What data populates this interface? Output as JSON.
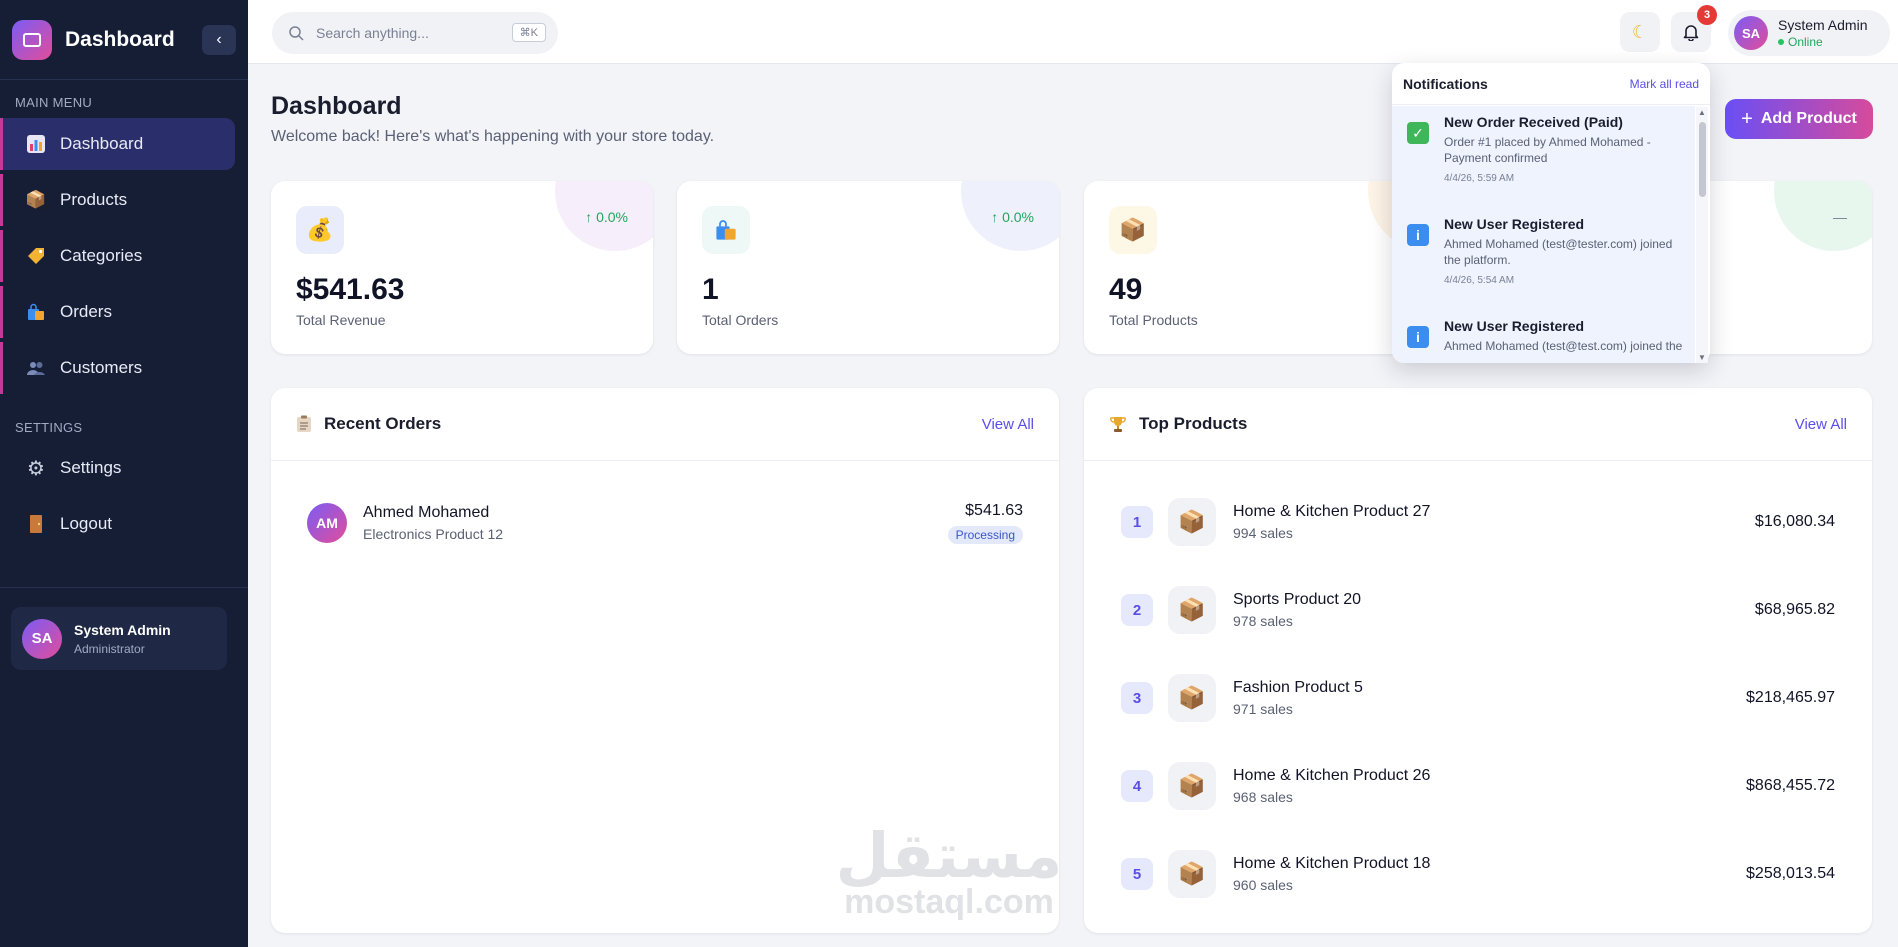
{
  "sidebar": {
    "title": "Dashboard",
    "collapse_icon": "chevron-left-icon",
    "main_menu_label": "MAIN MENU",
    "settings_label": "SETTINGS",
    "items": [
      {
        "label": "Dashboard",
        "icon": "chart-icon"
      },
      {
        "label": "Products",
        "icon": "package-icon"
      },
      {
        "label": "Categories",
        "icon": "tag-icon"
      },
      {
        "label": "Orders",
        "icon": "shopping-bag-icon"
      },
      {
        "label": "Customers",
        "icon": "users-icon"
      }
    ],
    "settings_items": [
      {
        "label": "Settings",
        "icon": "gear-icon"
      },
      {
        "label": "Logout",
        "icon": "door-icon"
      }
    ],
    "user": {
      "initials": "SA",
      "name": "System Admin",
      "role": "Administrator"
    }
  },
  "header": {
    "search_placeholder": "Search anything...",
    "shortcut": "⌘K",
    "notification_count": "3",
    "user": {
      "initials": "SA",
      "name": "System Admin",
      "status": "Online"
    }
  },
  "page": {
    "title": "Dashboard",
    "subtitle": "Welcome back! Here's what's happening with your store today.",
    "add_button": "Add Product"
  },
  "stats": [
    {
      "value": "$541.63",
      "label": "Total Revenue",
      "change": "↑ 0.0%",
      "icon": "money-bag-icon"
    },
    {
      "value": "1",
      "label": "Total Orders",
      "change": "↑ 0.0%",
      "icon": "shopping-bag-icon"
    },
    {
      "value": "49",
      "label": "Total Products",
      "change": "",
      "icon": "package-icon"
    },
    {
      "value": "",
      "label": "",
      "change": "—",
      "icon": ""
    }
  ],
  "recent_orders": {
    "title": "Recent Orders",
    "view_all": "View All",
    "rows": [
      {
        "initials": "AM",
        "name": "Ahmed Mohamed",
        "product": "Electronics Product 12",
        "amount": "$541.63",
        "status": "Processing"
      }
    ]
  },
  "top_products": {
    "title": "Top Products",
    "view_all": "View All",
    "rows": [
      {
        "rank": "1",
        "name": "Home & Kitchen Product 27",
        "sales": "994 sales",
        "price": "$16,080.34"
      },
      {
        "rank": "2",
        "name": "Sports Product 20",
        "sales": "978 sales",
        "price": "$68,965.82"
      },
      {
        "rank": "3",
        "name": "Fashion Product 5",
        "sales": "971 sales",
        "price": "$218,465.97"
      },
      {
        "rank": "4",
        "name": "Home & Kitchen Product 26",
        "sales": "968 sales",
        "price": "$868,455.72"
      },
      {
        "rank": "5",
        "name": "Home & Kitchen Product 18",
        "sales": "960 sales",
        "price": "$258,013.54"
      }
    ]
  },
  "notifications": {
    "title": "Notifications",
    "mark_all": "Mark all read",
    "items": [
      {
        "title": "New Order Received (Paid)",
        "message": "Order #1 placed by Ahmed Mohamed - Payment confirmed",
        "time": "4/4/26, 5:59 AM",
        "icon": "check-icon",
        "color": "#3fb65a"
      },
      {
        "title": "New User Registered",
        "message": "Ahmed Mohamed (test@tester.com) joined the platform.",
        "time": "4/4/26, 5:54 AM",
        "icon": "info-icon",
        "color": "#3b8df0"
      },
      {
        "title": "New User Registered",
        "message": "Ahmed Mohamed (test@test.com) joined the",
        "time": "",
        "icon": "info-icon",
        "color": "#3b8df0"
      }
    ]
  },
  "watermark": {
    "arabic": "مستقل",
    "latin": "mostaql.com"
  },
  "colors": {
    "sidebar_bg": "#161e36",
    "accent": "#5b4ee8",
    "gradient_start": "#6a4ff5",
    "gradient_end": "#d64b9c",
    "positive": "#22a55b"
  }
}
